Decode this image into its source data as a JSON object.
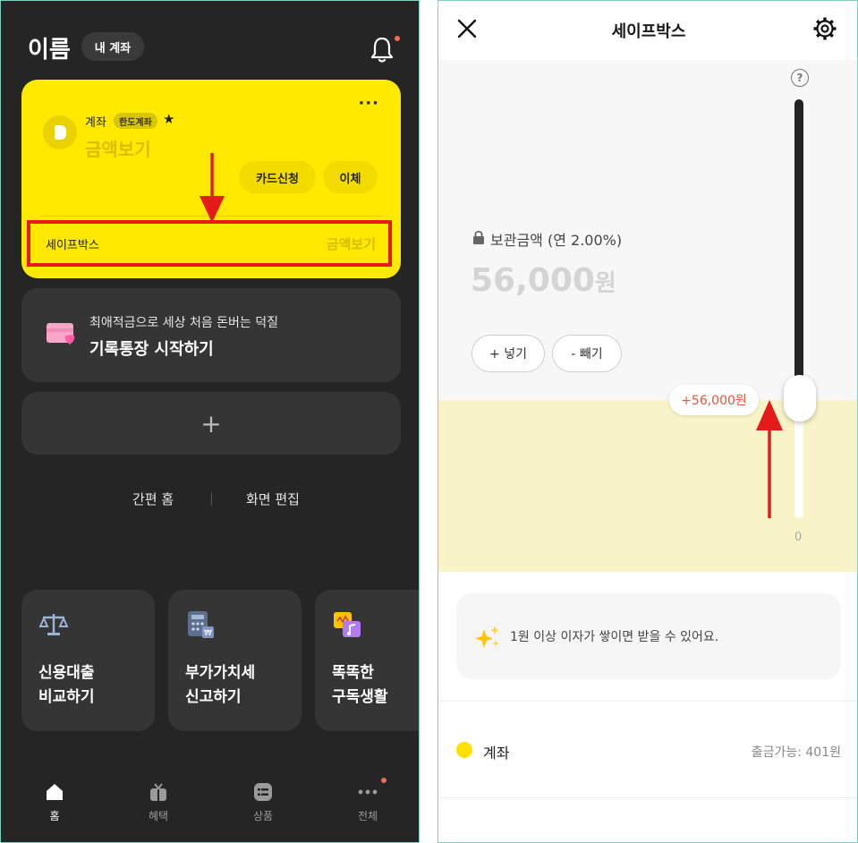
{
  "left": {
    "header": {
      "title": "이름",
      "my_account_label": "내 계좌"
    },
    "account_card": {
      "account_label": "계좌",
      "badge": "한도계좌",
      "star": "★",
      "amount_label": "금액보기",
      "more": "···",
      "card_apply_label": "카드신청",
      "transfer_label": "이체",
      "safebox": {
        "label": "세이프박스",
        "amount_label": "금액보기"
      }
    },
    "promo": {
      "subtitle": "최애적금으로 세상 처음 돈버는 덕질",
      "title": "기록통장 시작하기"
    },
    "add_label": "+",
    "quick_links": {
      "simple_home": "간편 홈",
      "edit_screen": "화면 편집"
    },
    "tiles": [
      {
        "title_line1": "신용대출",
        "title_line2": "비교하기",
        "icon": "scale-icon"
      },
      {
        "title_line1": "부가가치세",
        "title_line2": "신고하기",
        "icon": "calculator-icon"
      },
      {
        "title_line1": "똑똑한",
        "title_line2": "구독생활",
        "icon": "subscription-icon"
      }
    ],
    "tabbar": {
      "home": "홈",
      "benefit": "혜택",
      "product": "상품",
      "all": "전체"
    }
  },
  "right": {
    "title": "세이프박스",
    "keep_label": "보관금액 (연 2.00%)",
    "amount_value": "56,000",
    "amount_unit": "원",
    "deposit_label": "+ 넣기",
    "withdraw_label": "- 빼기",
    "slider_bubble": "+56,000원",
    "slider_min": "0",
    "help": "?",
    "info_text": "1원 이상 이자가 쌓이면 받을 수 있어요.",
    "account": {
      "name": "계좌",
      "available": "출금가능: 401원"
    }
  },
  "colors": {
    "card_yellow": "#ffe900",
    "highlight_red": "#e31b1b",
    "dark_bg": "#252525",
    "tile_bg": "#353535",
    "bubble_text": "#e05a3a",
    "band_yellow": "#f8f4c8"
  }
}
